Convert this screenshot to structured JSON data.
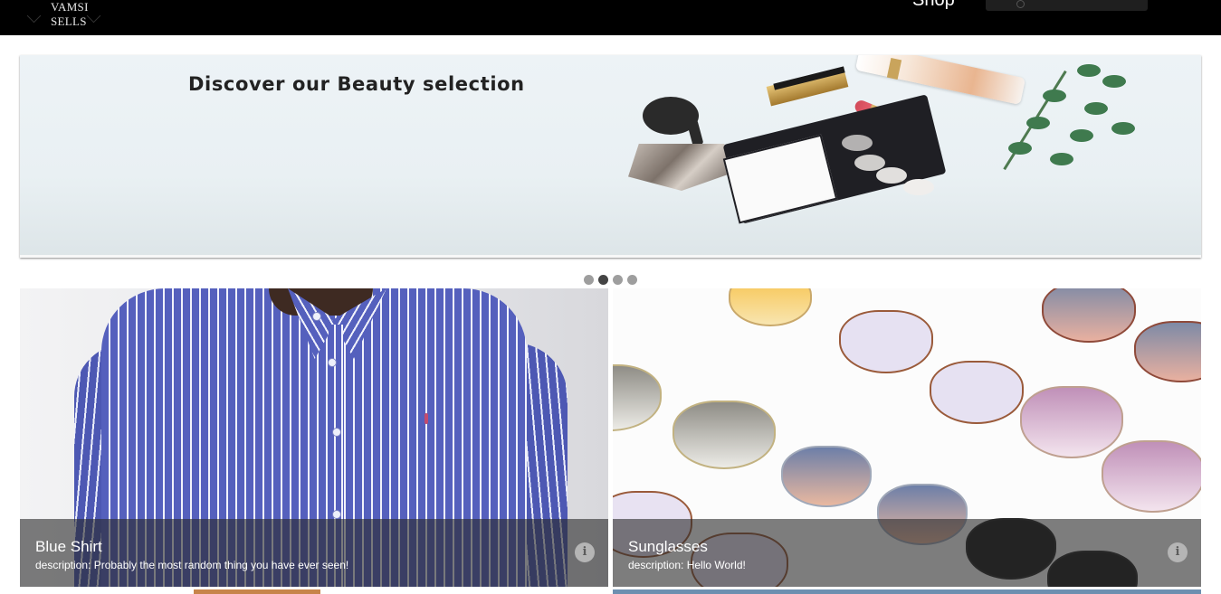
{
  "header": {
    "logo_text": "VAMSI SELLS",
    "nav_shop": "Shop",
    "search_icon": "search-icon"
  },
  "banner": {
    "headline": "Discover our Beauty selection"
  },
  "carousel": {
    "slide_count": 4,
    "active_index": 1
  },
  "products": [
    {
      "title": "Blue Shirt",
      "description": "description: Probably the most random thing you have ever seen!",
      "info_icon": "info-icon"
    },
    {
      "title": "Sunglasses",
      "description": "description: Hello World!",
      "info_icon": "info-icon"
    }
  ],
  "colors": {
    "header_bg": "#000000",
    "caption_bg": "rgba(40,40,40,0.6)",
    "dot_active": "#444444",
    "dot_inactive": "#9e9e9e"
  }
}
